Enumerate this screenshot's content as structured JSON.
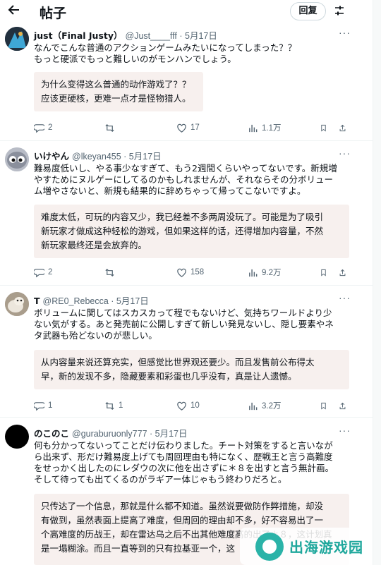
{
  "header": {
    "title": "帖子",
    "reply_label": "回复"
  },
  "icons": {
    "back": "arrow-left-icon",
    "filter": "sliders-icon",
    "reply": "speech-bubble-icon",
    "retweet": "retweet-icon",
    "like": "heart-icon",
    "views": "bar-chart-icon",
    "bookmark": "bookmark-icon",
    "share": "share-icon",
    "more": "more-dots-icon"
  },
  "posts": [
    {
      "name": "just（Final Justy）",
      "handle": "@Just____fff · 5月17日",
      "text_lines": [
        "なんでこんな普通のアクションゲームみたいになってしまった？？",
        "もっと硬派でもっと難しいのがモンハンでしょう。"
      ],
      "translation_lines": [
        "为什么变得这么普通的动作游戏了？？",
        "应该更硬核，更难一点才是怪物猎人。"
      ],
      "replies": "2",
      "retweets": "",
      "likes": "17",
      "views": "1.1万"
    },
    {
      "name": "いけやん",
      "handle": "@lkeyan455 · 5月17日",
      "text_lines": [
        "難易度低いし、やる事少なすぎて、もう2週間くらいやってないです。新規増",
        "やすためにヌルゲーにしてるのかもしれませんが、それならその分ボリュー",
        "ム増やさないと、新規も結果的に辞めちゃって帰ってこないですよ。"
      ],
      "translation_lines": [
        "难度太低，可玩的内容又少，我已经差不多两周没玩了。可能是为了吸引",
        "新玩家才做成这种轻松的游戏，但如果这样的话，还得增加内容量，不然",
        "新玩家最终还是会放弃的。"
      ],
      "replies": "2",
      "retweets": "",
      "likes": "158",
      "views": "9.2万"
    },
    {
      "name": "T",
      "handle": "@RE0_Rebecca · 5月17日",
      "text_lines": [
        "ボリュームに関してはスカスカって程でもないけど、気持ちワールドより少",
        "ない気がする。あと発売前に公開しすぎて新しい発見ないし、隠し要素やネ",
        "タ武器も殆どないのが悲しい。"
      ],
      "translation_lines": [
        "从内容量来说还算充实，但感觉比世界观还要少。而且发售前公布得太",
        "早，新的发现不多，隐藏要素和彩蛋也几乎没有，真是让人遗憾。"
      ],
      "replies": "1",
      "retweets": "1",
      "likes": "10",
      "views": "3.2万"
    },
    {
      "name": "のこのこ",
      "handle": "@guraburuonly777 · 5月17日",
      "text_lines": [
        "何も分かってないってことだけ伝わりました。チート対策をすると言いなが",
        "ら出来ず、形だけ難易度上げても周回理由も特になく、歴戦王と言う高難度",
        "をせっかく出したのにレダウの次に他を出さずに＊８を出すと言う無計画。",
        "そして待っても出てくるのがラギアー体じゃもう終わりだろと。"
      ],
      "translation_lines": [
        "只传达了一个信息，那就是什么都不知道。虽然说要做防作弊措施，却没",
        "有做到，虽然表面上提高了难度，但周回的理由却不多，好不容易出了一",
        "个高难度的历战王，却在雷达乌之后不出其他难度高的出了＊８，这计划真",
        "是一塌糊涂。而且一直等到的只有拉基亚一个，这"
      ],
      "replies": "",
      "retweets": "",
      "likes": "",
      "views": ""
    }
  ],
  "watermark": {
    "text": "出海游戏园"
  }
}
